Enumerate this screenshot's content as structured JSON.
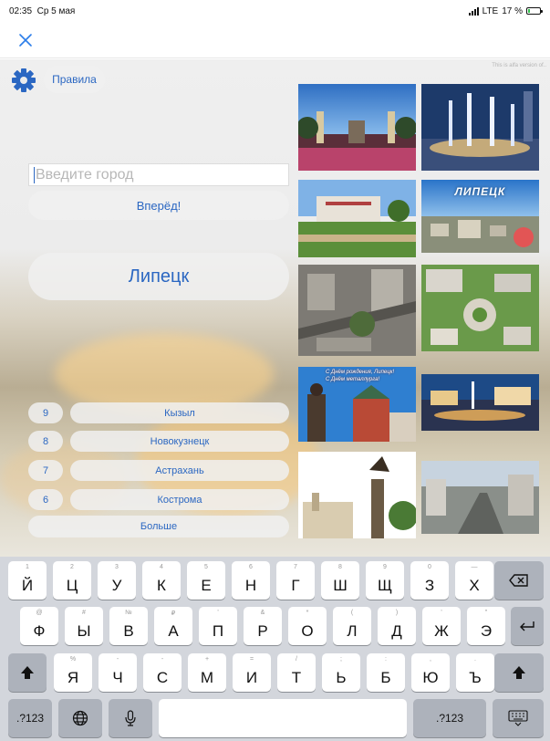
{
  "status_bar": {
    "time": "02:35",
    "date": "Ср 5 мая",
    "network": "LTE",
    "battery": "17 %"
  },
  "app": {
    "alpha_note": "This is alfa version of..",
    "rules_label": "Правила",
    "input_placeholder": "Введите город",
    "go_label": "Вперёд!",
    "current_city": "Липецк",
    "history": [
      {
        "num": "9",
        "city": "Кызыл"
      },
      {
        "num": "8",
        "city": "Новокузнецк"
      },
      {
        "num": "7",
        "city": "Астрахань"
      },
      {
        "num": "6",
        "city": "Кострома"
      }
    ],
    "more_label": "Больше",
    "photo_texts": {
      "logo": "ЛИПЕЦК",
      "greeting_1": "С Днём рождения, Липецк!",
      "greeting_2": "С Днём металлурга!"
    }
  },
  "keyboard": {
    "row1": [
      {
        "sub": "1",
        "ch": "Й"
      },
      {
        "sub": "2",
        "ch": "Ц"
      },
      {
        "sub": "3",
        "ch": "У"
      },
      {
        "sub": "4",
        "ch": "К"
      },
      {
        "sub": "5",
        "ch": "Е"
      },
      {
        "sub": "6",
        "ch": "Н"
      },
      {
        "sub": "7",
        "ch": "Г"
      },
      {
        "sub": "8",
        "ch": "Ш"
      },
      {
        "sub": "9",
        "ch": "Щ"
      },
      {
        "sub": "0",
        "ch": "З"
      },
      {
        "sub": "—",
        "ch": "Х"
      }
    ],
    "row2": [
      {
        "sub": "@",
        "ch": "Ф"
      },
      {
        "sub": "#",
        "ch": "Ы"
      },
      {
        "sub": "№",
        "ch": "В"
      },
      {
        "sub": "₽",
        "ch": "А"
      },
      {
        "sub": "'",
        "ch": "П"
      },
      {
        "sub": "&",
        "ch": "Р"
      },
      {
        "sub": "*",
        "ch": "О"
      },
      {
        "sub": "(",
        "ch": "Л"
      },
      {
        "sub": ")",
        "ch": "Д"
      },
      {
        "sub": "'",
        "ch": "Ж"
      },
      {
        "sub": "\"",
        "ch": "Э"
      }
    ],
    "row3": [
      {
        "sub": "%",
        "ch": "Я"
      },
      {
        "sub": "-",
        "ch": "Ч"
      },
      {
        "sub": "-",
        "ch": "С"
      },
      {
        "sub": "+",
        "ch": "М"
      },
      {
        "sub": "=",
        "ch": "И"
      },
      {
        "sub": "/",
        "ch": "Т"
      },
      {
        "sub": ";",
        "ch": "Ь"
      },
      {
        "sub": ":",
        "ch": "Б"
      },
      {
        "sub": ",",
        "ch": "Ю"
      },
      {
        "sub": ".",
        "ch": "Ъ"
      }
    ],
    "num_label_left": ".?123",
    "num_label_right": ".?123"
  },
  "colors": {
    "accent": "#2b67c2",
    "battery": "#33c24d",
    "keyboard_bg": "#d3d6dc"
  }
}
